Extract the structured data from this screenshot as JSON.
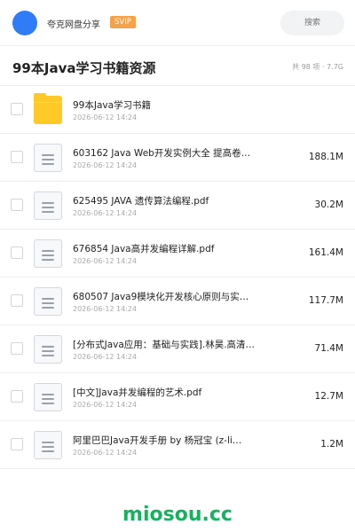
{
  "header": {
    "brand": "夸克网盘分享",
    "badge": "SVIP",
    "search_placeholder": "搜索"
  },
  "folder": {
    "title": "99本Java学习书籍资源",
    "meta": "共 98 项 · 7.7G"
  },
  "files": [
    {
      "type": "folder",
      "name": "99本Java学习书籍",
      "date": "2026-06-12 14:24",
      "size": ""
    },
    {
      "type": "doc",
      "name": "603162 Java Web开发实例大全 提高卷…",
      "date": "2026-06-12 14:24",
      "size": "188.1M"
    },
    {
      "type": "doc",
      "name": "625495 JAVA 遗传算法编程.pdf",
      "date": "2026-06-12 14:24",
      "size": "30.2M"
    },
    {
      "type": "doc",
      "name": "676854 Java高并发编程详解.pdf",
      "date": "2026-06-12 14:24",
      "size": "161.4M"
    },
    {
      "type": "doc",
      "name": "680507 Java9模块化开发核心原则与实践.…",
      "date": "2026-06-12 14:24",
      "size": "117.7M"
    },
    {
      "type": "doc",
      "name": "[分布式Java应用：基础与实践].林昊.高清文字…",
      "date": "2026-06-12 14:24",
      "size": "71.4M"
    },
    {
      "type": "doc",
      "name": "[中文]Java并发编程的艺术.pdf",
      "date": "2026-06-12 14:24",
      "size": "12.7M"
    },
    {
      "type": "doc",
      "name": "阿里巴巴Java开发手册 by 杨冠宝 (z-li…",
      "date": "2026-06-12 14:24",
      "size": "1.2M"
    }
  ],
  "footer": {
    "watermark": "miosou.cc"
  },
  "colors": {
    "avatar": "#2f7cf6",
    "badge": "#f5a24a",
    "folder_icon": "#ffc928",
    "watermark": "#16b35e"
  },
  "icons": {
    "folder": "folder-icon",
    "file": "document-icon"
  }
}
